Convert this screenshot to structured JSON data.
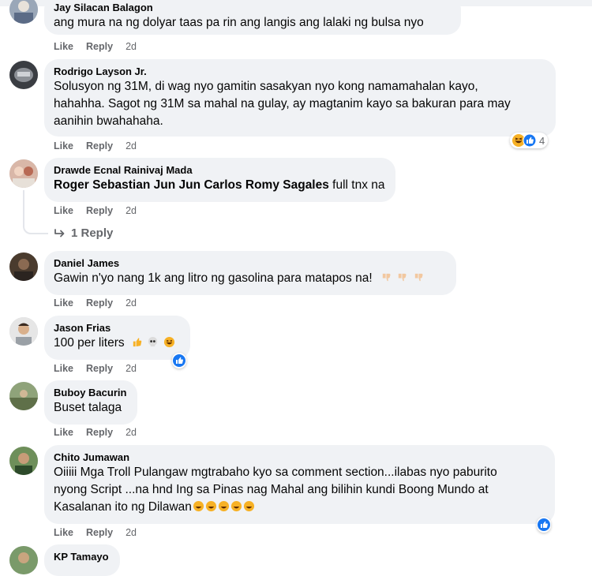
{
  "comments": [
    {
      "author": "Jay Silacan Balagon",
      "text": "ang mura na ng dolyar taas pa rin ang langis ang lalaki ng bulsa nyo",
      "like": "Like",
      "reply": "Reply",
      "time": "2d"
    },
    {
      "author": "Rodrigo Layson Jr.",
      "lines": [
        "Solusyon ng 31M, di wag nyo gamitin sasakyan nyo kong namamahalan kayo,",
        "hahahha. Sagot ng 31M sa mahal na gulay, ay magtanim kayo sa bakuran para may",
        "aanihin bwahahaha."
      ],
      "like": "Like",
      "reply": "Reply",
      "time": "2d",
      "reaction_count": "4"
    },
    {
      "author": "Drawde Ecnal Rainivaj Mada",
      "tagged": "Roger Sebastian Jun Jun Carlos Romy Sagales",
      "text": " full tnx na",
      "like": "Like",
      "reply": "Reply",
      "time": "2d",
      "replies_label": "1 Reply"
    },
    {
      "author": "Daniel James",
      "text": "Gawin n'yo nang 1k ang litro ng gasolina para matapos na!",
      "like": "Like",
      "reply": "Reply",
      "time": "2d"
    },
    {
      "author": "Jason Frias",
      "text": "100 per liters",
      "like": "Like",
      "reply": "Reply",
      "time": "2d"
    },
    {
      "author": "Buboy Bacurin",
      "text": "Buset talaga",
      "like": "Like",
      "reply": "Reply",
      "time": "2d"
    },
    {
      "author": "Chito Jumawan",
      "lines": [
        "Oiiiii Mga Troll Pulangaw mgtrabaho kyo sa comment section...ilabas nyo paburito",
        "nyong Script ...na hnd Ing sa Pinas nag Mahal ang bilihin kundi Boong Mundo at",
        "Kasalanan ito ng Dilawan"
      ],
      "like": "Like",
      "reply": "Reply",
      "time": "2d"
    },
    {
      "author": "KP Tamayo"
    }
  ],
  "colors": {
    "bubble": "#f0f2f5",
    "meta_text": "#65676b",
    "like_blue": "#1877f2",
    "haha_yellow": "#f7b125"
  }
}
